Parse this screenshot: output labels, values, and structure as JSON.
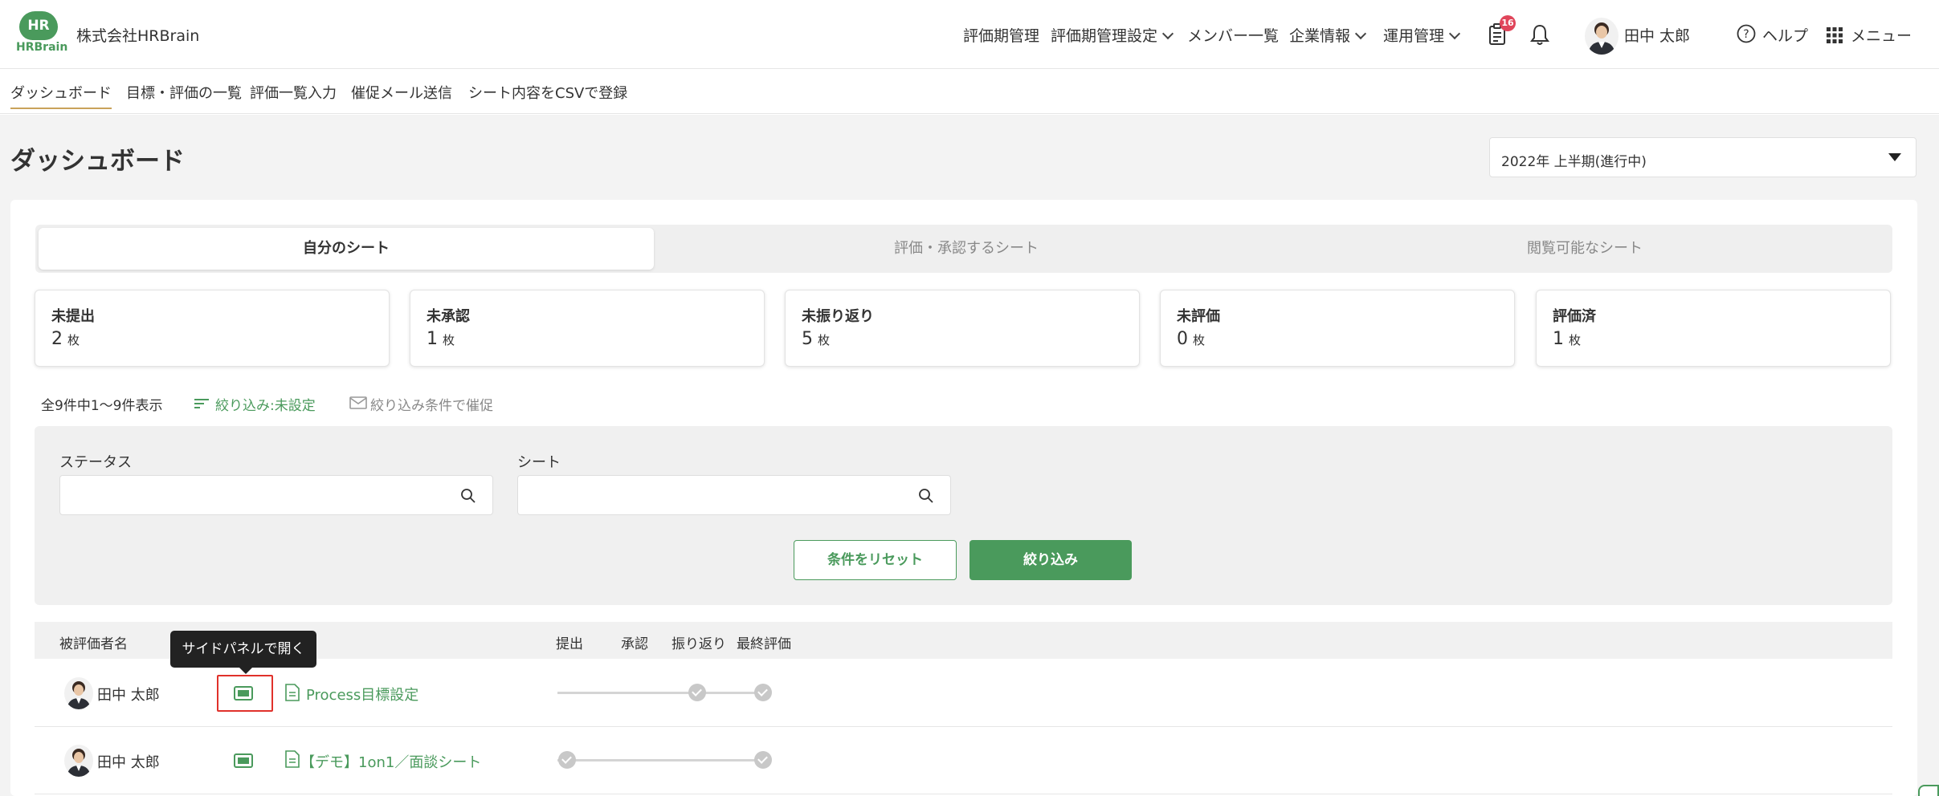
{
  "header": {
    "logo_text": "HR",
    "logo_word": "HRBrain",
    "company": "株式会社HRBrain",
    "nav": [
      {
        "label": "評価期管理",
        "dropdown": false
      },
      {
        "label": "評価期管理設定",
        "dropdown": true
      },
      {
        "label": "メンバー一覧",
        "dropdown": false
      },
      {
        "label": "企業情報",
        "dropdown": true
      },
      {
        "label": "運用管理",
        "dropdown": true
      }
    ],
    "notification_count": "16",
    "user_name": "田中 太郎",
    "help": "ヘルプ",
    "menu": "メニュー"
  },
  "subnav": [
    "ダッシュボード",
    "目標・評価の一覧",
    "評価一覧入力",
    "催促メール送信",
    "シート内容をCSVで登録"
  ],
  "page": {
    "title": "ダッシュボード",
    "period": "2022年 上半期(進行中)"
  },
  "tabs": [
    "自分のシート",
    "評価・承認するシート",
    "閲覧可能なシート"
  ],
  "stats": [
    {
      "label": "未提出",
      "value": "2",
      "unit": "枚"
    },
    {
      "label": "未承認",
      "value": "1",
      "unit": "枚"
    },
    {
      "label": "未振り返り",
      "value": "5",
      "unit": "枚"
    },
    {
      "label": "未評価",
      "value": "0",
      "unit": "枚"
    },
    {
      "label": "評価済",
      "value": "1",
      "unit": "枚"
    }
  ],
  "list_meta": {
    "count": "全9件中1〜9件表示",
    "filter_link": "絞り込み:未設定",
    "mail_link": "絞り込み条件で催促"
  },
  "filters": {
    "status_label": "ステータス",
    "status_value": "",
    "sheet_label": "シート",
    "sheet_value": "",
    "reset": "条件をリセット",
    "apply": "絞り込み"
  },
  "table": {
    "headers": [
      "被評価者名",
      "提出",
      "承認",
      "振り返り",
      "最終評価"
    ],
    "rows": [
      {
        "name": "田中 太郎",
        "sheet": "Process目標設定"
      },
      {
        "name": "田中 太郎",
        "sheet": "【デモ】1on1／面談シート"
      }
    ]
  },
  "tooltip": "サイドパネルで開く",
  "colors": {
    "brand_green": "#4a9a5c",
    "badge_red": "#e0455a",
    "highlight_red": "#e0312b",
    "active_underline": "#c9a25a"
  }
}
